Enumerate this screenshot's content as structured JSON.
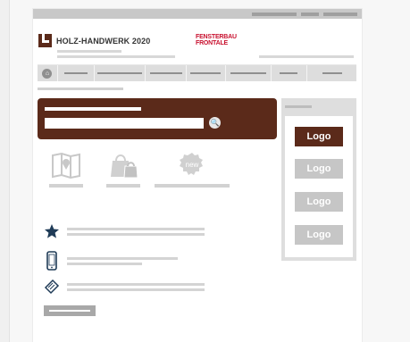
{
  "brand": {
    "name": "HOLZ-HANDWERK 2020"
  },
  "partner": {
    "line1": "FENSTERBAU",
    "line2": "FRONTALE"
  },
  "sidebar": {
    "logos": [
      {
        "label": "Logo",
        "active": true
      },
      {
        "label": "Logo",
        "active": false
      },
      {
        "label": "Logo",
        "active": false
      },
      {
        "label": "Logo",
        "active": false
      }
    ]
  },
  "features": [
    {
      "icon": "map-icon"
    },
    {
      "icon": "shopping-bag-icon"
    },
    {
      "icon": "new-badge-icon",
      "badge_text": "new"
    }
  ],
  "info_items": [
    {
      "icon": "star-icon"
    },
    {
      "icon": "smartphone-icon"
    },
    {
      "icon": "ticket-icon"
    }
  ],
  "colors": {
    "brand": "#5b2a1a",
    "accent_red": "#c8102e",
    "star": "#1f3b57",
    "logo_inactive": "#c6c6c6"
  }
}
